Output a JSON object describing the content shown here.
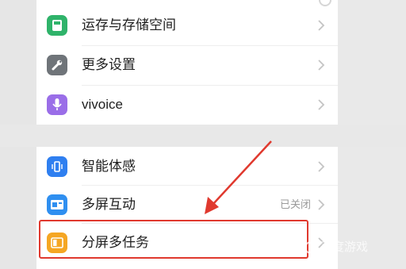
{
  "settings": {
    "items": [
      {
        "label": "运存与存储空间",
        "icon": "storage-icon",
        "color": "#2fb36a",
        "value": ""
      },
      {
        "label": "更多设置",
        "icon": "wrench-icon",
        "color": "#6f7479",
        "value": ""
      },
      {
        "label": "vivoice",
        "icon": "microphone-icon",
        "color": "#9a6ee8",
        "value": ""
      },
      {
        "label": "智能体感",
        "icon": "phone-motion-icon",
        "color": "#2f7ff0",
        "value": ""
      },
      {
        "label": "多屏互动",
        "icon": "cast-icon",
        "color": "#2f8ff0",
        "value": "已关闭"
      },
      {
        "label": "分屏多任务",
        "icon": "split-screen-icon",
        "color": "#f5a623",
        "value": ""
      }
    ]
  },
  "annotation": {
    "highlight_color": "#e0392e",
    "arrow_color": "#e0392e"
  },
  "watermark": {
    "text": "百度游戏"
  }
}
